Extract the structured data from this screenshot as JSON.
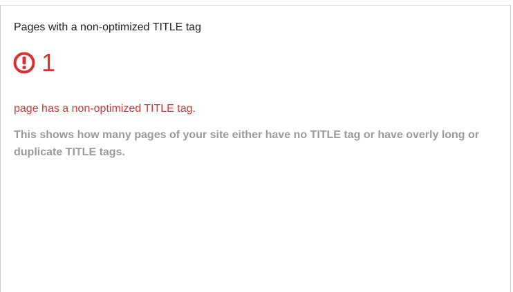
{
  "card": {
    "title": "Pages with a non-optimized TITLE tag",
    "metric": {
      "icon": "exclamation-circle-icon",
      "value": "1",
      "color": "#dc3030"
    },
    "status_text": "page has a non-optimized TITLE tag.",
    "description": "This shows how many pages of your site either have no TITLE tag or have overly long or duplicate TITLE tags."
  }
}
